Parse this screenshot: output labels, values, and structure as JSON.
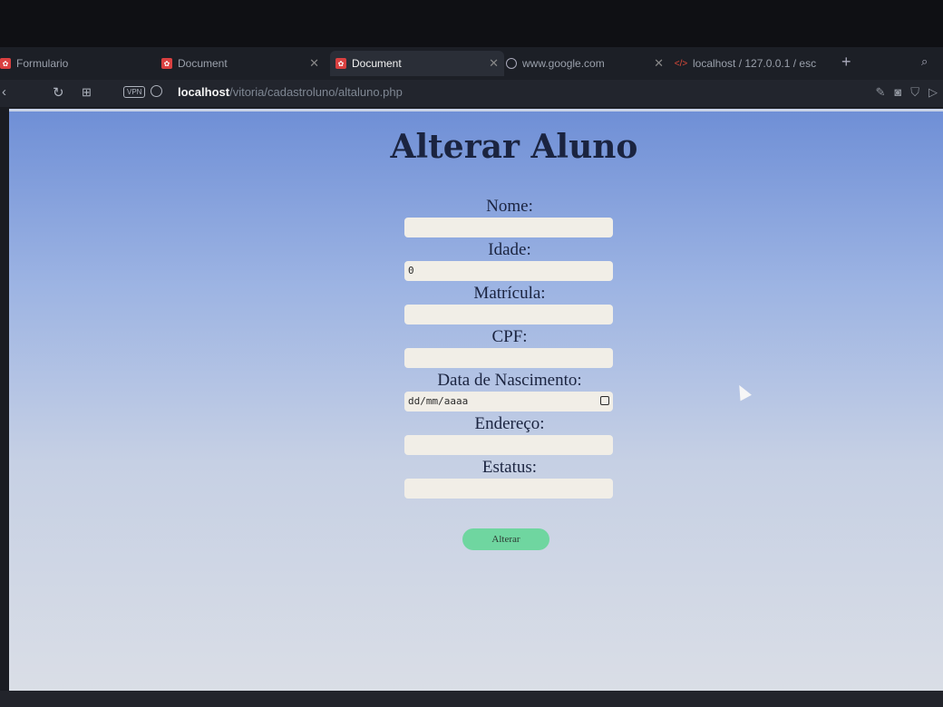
{
  "tabs": [
    {
      "label": "Formulario"
    },
    {
      "label": "Document"
    },
    {
      "label": "Document"
    },
    {
      "label": "www.google.com"
    },
    {
      "label": "localhost / 127.0.0.1 / esc"
    }
  ],
  "addressbar": {
    "vpn_label": "VPN",
    "url_host": "localhost",
    "url_path": "/vitoria/cadastroluno/altaluno.php"
  },
  "page": {
    "title": "Alterar Aluno",
    "fields": [
      {
        "label": "Nome:",
        "value": ""
      },
      {
        "label": "Idade:",
        "value": "0"
      },
      {
        "label": "Matrícula:",
        "value": ""
      },
      {
        "label": "CPF:",
        "value": ""
      },
      {
        "label": "Data de Nascimento:",
        "value": "dd/mm/aaaa"
      },
      {
        "label": "Endereço:",
        "value": ""
      },
      {
        "label": "Estatus:",
        "value": ""
      }
    ],
    "submit_label": "Alterar"
  },
  "colors": {
    "title": "#1b2440",
    "input_bg": "#f1eee7",
    "button_bg": "#6fd6a0"
  }
}
